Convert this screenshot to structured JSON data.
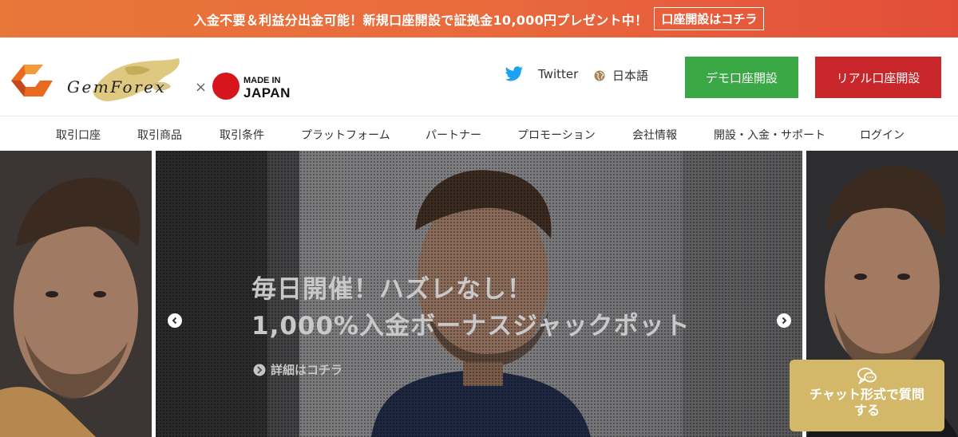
{
  "promo": {
    "text": "入金不要＆利益分出金可能！新規口座開設で証拠金10,000円プレゼント中！",
    "button": "口座開設はコチラ"
  },
  "header": {
    "logo": {
      "brand": "GemForex",
      "separator": "×",
      "made_in": "MADE IN",
      "japan": "JAPAN"
    },
    "twitter_label": "Twitter",
    "language_label": "日本語",
    "demo_button": "デモ口座開設",
    "real_button": "リアル口座開設"
  },
  "nav": {
    "items": [
      {
        "label": "取引口座"
      },
      {
        "label": "取引商品"
      },
      {
        "label": "取引条件"
      },
      {
        "label": "プラットフォーム"
      },
      {
        "label": "パートナー"
      },
      {
        "label": "プロモーション"
      },
      {
        "label": "会社情報"
      },
      {
        "label": "開設・入金・サポート"
      },
      {
        "label": "ログイン"
      }
    ]
  },
  "hero": {
    "title_line1": "毎日開催！ハズレなし！",
    "title_line2": "1,000%入金ボーナスジャックポット",
    "link_label": "詳細はコチラ"
  },
  "chat": {
    "label_line1": "チャット形式で質問",
    "label_line2": "する"
  },
  "colors": {
    "promo_start": "#e8773a",
    "promo_end": "#e24d3a",
    "demo_button": "#3aa844",
    "real_button": "#c8262a",
    "chat_widget": "#d4b86a"
  },
  "icons": [
    "twitter-bird-icon",
    "globe-icon",
    "arrow-circle-right-icon",
    "chevron-left-icon",
    "chevron-right-icon",
    "chat-bubble-icon"
  ]
}
